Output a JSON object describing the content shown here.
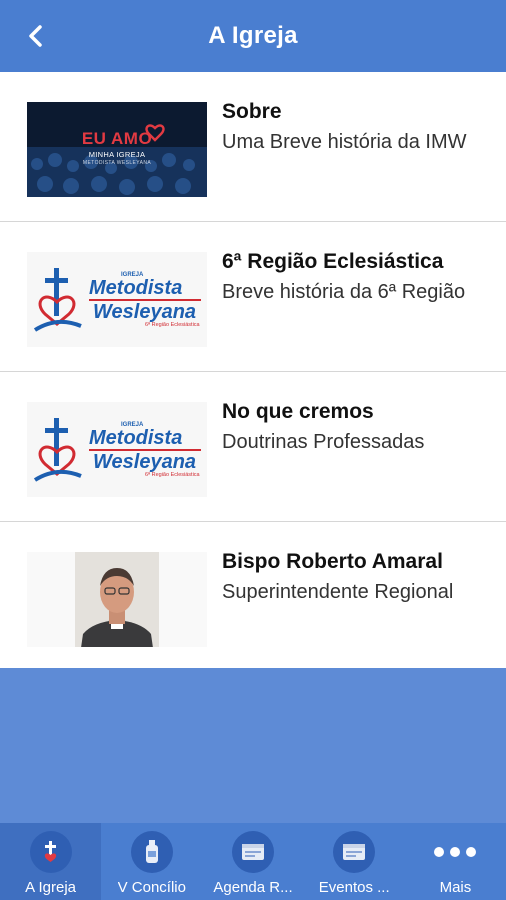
{
  "header": {
    "title": "A Igreja"
  },
  "items": [
    {
      "title": "Sobre",
      "subtitle": "Uma Breve história da IMW",
      "banner_line1": "EU AMO",
      "banner_line2": "MINHA IGREJA",
      "banner_line3": "METODISTA WESLEYANA"
    },
    {
      "title": "6ª Região Eclesiástica",
      "subtitle": "Breve história da 6ª Região",
      "logo_small": "IGREJA",
      "logo_line1": "Metodista",
      "logo_line2": "Wesleyana",
      "logo_tag": "6ª Região Eclesiástica"
    },
    {
      "title": "No que cremos",
      "subtitle": "Doutrinas Professadas",
      "logo_small": "IGREJA",
      "logo_line1": "Metodista",
      "logo_line2": "Wesleyana",
      "logo_tag": "6ª Região Eclesiástica"
    },
    {
      "title": "Bispo Roberto Amaral",
      "subtitle": "Superintendente Regional"
    }
  ],
  "tabs": [
    {
      "label": "A Igreja",
      "icon": "church-icon",
      "active": true
    },
    {
      "label": "V Concílio",
      "icon": "bottle-icon"
    },
    {
      "label": "Agenda R...",
      "icon": "calendar-icon"
    },
    {
      "label": "Eventos ...",
      "icon": "events-icon"
    },
    {
      "label": "Mais",
      "icon": "more-icon"
    }
  ],
  "colors": {
    "header": "#4a7ed0",
    "background": "#5e8bd6",
    "logo_blue": "#1d5fb0",
    "logo_red": "#d12b32"
  }
}
